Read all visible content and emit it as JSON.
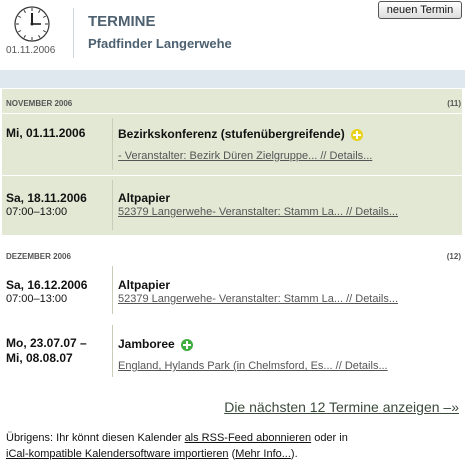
{
  "header": {
    "date": "01.11.2006",
    "title": "TERMINE",
    "subtitle": "Pfadfinder Langerwehe",
    "new_button": "neuen Termin"
  },
  "months": [
    {
      "label": "NOVEMBER 2006",
      "count": "(11)",
      "events": [
        {
          "date": "Mi, 01.11.2006",
          "time": "",
          "title": "Bezirkskonferenz (stufenübergreifende)",
          "detail": "- Veranstalter: Bezirk Düren Zielgruppe... // Details...",
          "icon": "yellow-cross-icon"
        },
        {
          "date": "Sa, 18.11.2006",
          "time": "07:00–13:00",
          "title": "Altpapier",
          "detail": "52379 Langerwehe- Veranstalter: Stamm La... // Details..."
        }
      ]
    },
    {
      "label": "DEZEMBER 2006",
      "count": "(12)",
      "events": [
        {
          "date": "Sa, 16.12.2006",
          "time": "07:00–13:00",
          "title": "Altpapier",
          "detail": "52379 Langerwehe- Veranstalter: Stamm La... // Details..."
        },
        {
          "date": "Mo, 23.07.07 –",
          "date2": "Mi, 08.08.07",
          "title": "Jamboree",
          "detail": "England, Hylands Park (in Chelmsford, Es... // Details...",
          "icon": "green-cross-icon"
        }
      ]
    }
  ],
  "more_link": "Die nächsten 12 Termine anzeigen –»",
  "footnote": {
    "text1": "Übrigens: Ihr könnt diesen Kalender ",
    "link1": "als RSS-Feed abonnieren",
    "text2": " oder in",
    "link2": "iCal-kompatible Kalendersoftware importieren",
    "text3": " (",
    "link3": "Mehr Info...",
    "text4": ")."
  },
  "colors": {
    "accent_title": "#4d6170",
    "band": "#e3e8d5",
    "yellow_icon": "#e8d21c",
    "green_icon": "#3fae3f"
  }
}
